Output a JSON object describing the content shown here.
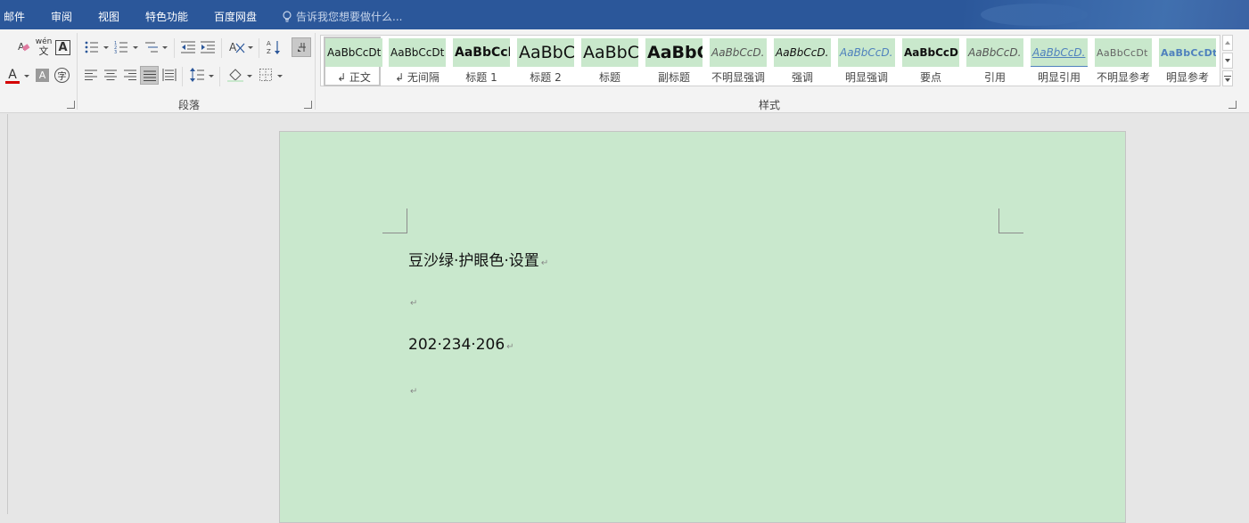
{
  "menubar": {
    "tabs": [
      {
        "label": "邮件"
      },
      {
        "label": "审阅"
      },
      {
        "label": "视图"
      },
      {
        "label": "特色功能"
      },
      {
        "label": "百度网盘"
      }
    ],
    "tell_me_placeholder": "告诉我您想要做什么..."
  },
  "ribbon": {
    "groups": {
      "paragraph": "段落",
      "styles": "样式"
    },
    "font_color": "#d40000",
    "ruby_label": "wén",
    "ruby_char": "文",
    "char_border_glyph": "A",
    "char_shade_glyph": "A",
    "enclose_glyph": "字",
    "font_color_glyph": "A"
  },
  "styles_gallery": [
    {
      "preview": "AaBbCcDt",
      "name": "↲ 正文",
      "selected": true
    },
    {
      "preview": "AaBbCcDt",
      "name": "↲ 无间隔"
    },
    {
      "preview": "AaBbCcI",
      "name": "标题 1"
    },
    {
      "preview": "AaBbC",
      "name": "标题 2"
    },
    {
      "preview": "AaBbC",
      "name": "标题"
    },
    {
      "preview": "AaBbC",
      "name": "副标题"
    },
    {
      "preview": "AaBbCcD.",
      "name": "不明显强调"
    },
    {
      "preview": "AaBbCcD.",
      "name": "强调"
    },
    {
      "preview": "AaBbCcD.",
      "name": "明显强调"
    },
    {
      "preview": "AaBbCcD.",
      "name": "要点"
    },
    {
      "preview": "AaBbCcD.",
      "name": "引用"
    },
    {
      "preview": "AaBbCcD.",
      "name": "明显引用"
    },
    {
      "preview": "AaBbCcDt",
      "name": "不明显参考"
    },
    {
      "preview": "AaBbCcDt",
      "name": "明显参考"
    }
  ],
  "document": {
    "page_color": "#c9e8cd",
    "line1": "豆沙绿·护眼色·设置",
    "line2": "202·234·206",
    "paragraph_mark": "↵"
  }
}
